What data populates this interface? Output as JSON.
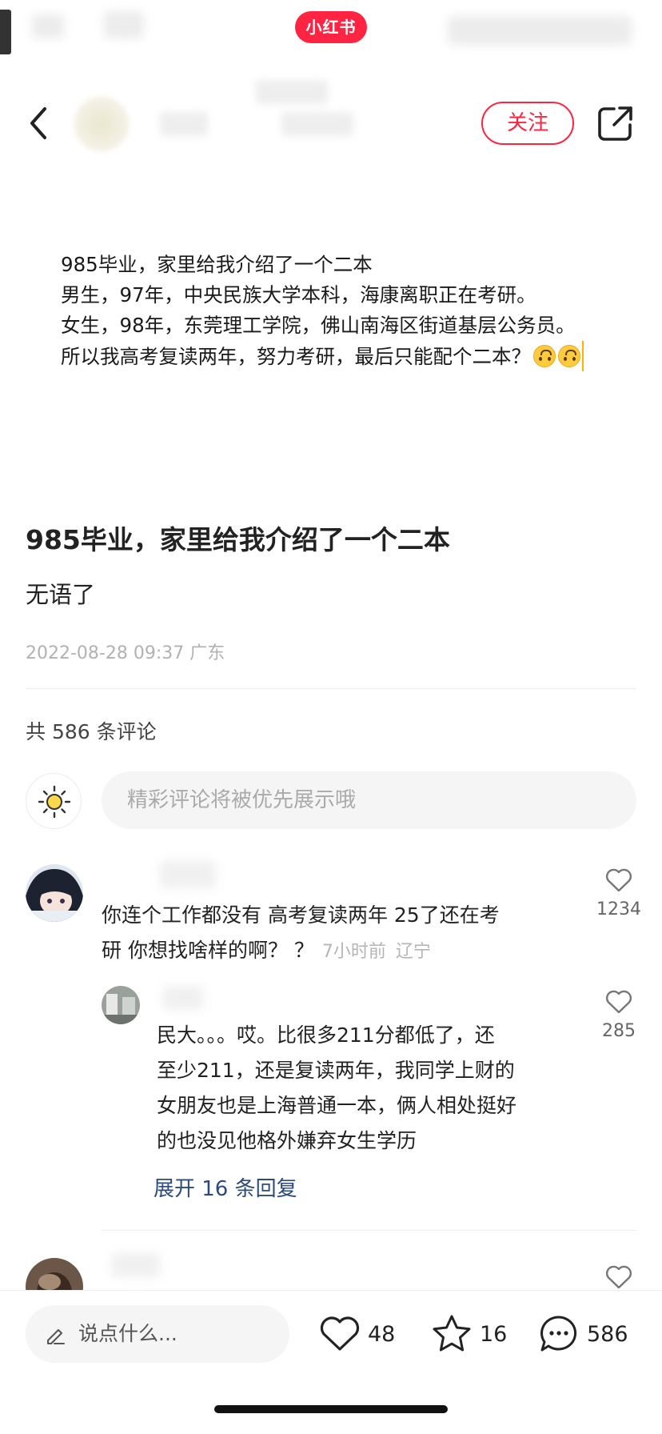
{
  "app": {
    "brand": "小红书",
    "accent_color": "#ff2442"
  },
  "header": {
    "back_icon": "chevron-left-icon",
    "follow_label": "关注",
    "share_icon": "share-icon"
  },
  "post_image": {
    "lines": [
      "985毕业，家里给我介绍了一个二本",
      "男生，97年，中央民族大学本科，海康离职正在考研。",
      "女生，98年，东莞理工学院，佛山南海区街道基层公务员。",
      "所以我高考复读两年，努力考研，最后只能配个二本？"
    ],
    "emoji": "upside-down-face-icon"
  },
  "post": {
    "title": "985毕业，家里给我介绍了一个二本",
    "description": "无语了",
    "timestamp": "2022-08-28 09:37",
    "location": "广东"
  },
  "comments_section": {
    "count_label": "共 586 条评论",
    "input_placeholder": "精彩评论将被优先展示哦",
    "comments": [
      {
        "text_line1": "你连个工作都没有 高考复读两年 25了还在考",
        "text_line2": "研 你想找啥样的啊？ ？",
        "time": "7小时前",
        "location": "辽宁",
        "likes": "1234"
      }
    ],
    "reply": {
      "lines": [
        "民大。。。哎。比很多211分都低了，还",
        "至少211，还是复读两年，我同学上财的",
        "女朋友也是上海普通一本，俩人相处挺好",
        "的也没见他格外嫌弃女生学历"
      ],
      "likes": "285"
    },
    "expand_label": "展开 16 条回复"
  },
  "bottom_bar": {
    "say_placeholder": "说点什么...",
    "likes": "48",
    "stars": "16",
    "comments": "586"
  }
}
